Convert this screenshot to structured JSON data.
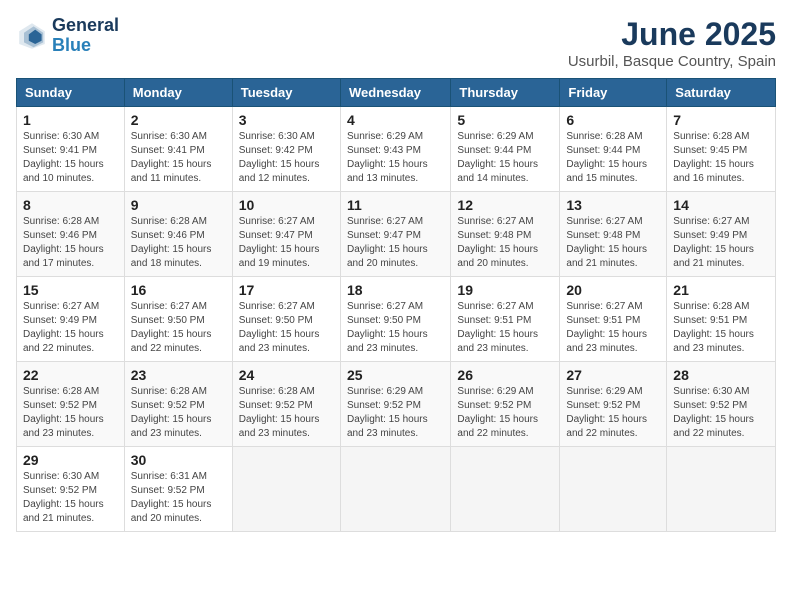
{
  "header": {
    "logo_line1": "General",
    "logo_line2": "Blue",
    "month_title": "June 2025",
    "location": "Usurbil, Basque Country, Spain"
  },
  "columns": [
    "Sunday",
    "Monday",
    "Tuesday",
    "Wednesday",
    "Thursday",
    "Friday",
    "Saturday"
  ],
  "weeks": [
    [
      {
        "day": "1",
        "sunrise": "6:30 AM",
        "sunset": "9:41 PM",
        "daylight": "15 hours and 10 minutes."
      },
      {
        "day": "2",
        "sunrise": "6:30 AM",
        "sunset": "9:41 PM",
        "daylight": "15 hours and 11 minutes."
      },
      {
        "day": "3",
        "sunrise": "6:30 AM",
        "sunset": "9:42 PM",
        "daylight": "15 hours and 12 minutes."
      },
      {
        "day": "4",
        "sunrise": "6:29 AM",
        "sunset": "9:43 PM",
        "daylight": "15 hours and 13 minutes."
      },
      {
        "day": "5",
        "sunrise": "6:29 AM",
        "sunset": "9:44 PM",
        "daylight": "15 hours and 14 minutes."
      },
      {
        "day": "6",
        "sunrise": "6:28 AM",
        "sunset": "9:44 PM",
        "daylight": "15 hours and 15 minutes."
      },
      {
        "day": "7",
        "sunrise": "6:28 AM",
        "sunset": "9:45 PM",
        "daylight": "15 hours and 16 minutes."
      }
    ],
    [
      {
        "day": "8",
        "sunrise": "6:28 AM",
        "sunset": "9:46 PM",
        "daylight": "15 hours and 17 minutes."
      },
      {
        "day": "9",
        "sunrise": "6:28 AM",
        "sunset": "9:46 PM",
        "daylight": "15 hours and 18 minutes."
      },
      {
        "day": "10",
        "sunrise": "6:27 AM",
        "sunset": "9:47 PM",
        "daylight": "15 hours and 19 minutes."
      },
      {
        "day": "11",
        "sunrise": "6:27 AM",
        "sunset": "9:47 PM",
        "daylight": "15 hours and 20 minutes."
      },
      {
        "day": "12",
        "sunrise": "6:27 AM",
        "sunset": "9:48 PM",
        "daylight": "15 hours and 20 minutes."
      },
      {
        "day": "13",
        "sunrise": "6:27 AM",
        "sunset": "9:48 PM",
        "daylight": "15 hours and 21 minutes."
      },
      {
        "day": "14",
        "sunrise": "6:27 AM",
        "sunset": "9:49 PM",
        "daylight": "15 hours and 21 minutes."
      }
    ],
    [
      {
        "day": "15",
        "sunrise": "6:27 AM",
        "sunset": "9:49 PM",
        "daylight": "15 hours and 22 minutes."
      },
      {
        "day": "16",
        "sunrise": "6:27 AM",
        "sunset": "9:50 PM",
        "daylight": "15 hours and 22 minutes."
      },
      {
        "day": "17",
        "sunrise": "6:27 AM",
        "sunset": "9:50 PM",
        "daylight": "15 hours and 23 minutes."
      },
      {
        "day": "18",
        "sunrise": "6:27 AM",
        "sunset": "9:50 PM",
        "daylight": "15 hours and 23 minutes."
      },
      {
        "day": "19",
        "sunrise": "6:27 AM",
        "sunset": "9:51 PM",
        "daylight": "15 hours and 23 minutes."
      },
      {
        "day": "20",
        "sunrise": "6:27 AM",
        "sunset": "9:51 PM",
        "daylight": "15 hours and 23 minutes."
      },
      {
        "day": "21",
        "sunrise": "6:28 AM",
        "sunset": "9:51 PM",
        "daylight": "15 hours and 23 minutes."
      }
    ],
    [
      {
        "day": "22",
        "sunrise": "6:28 AM",
        "sunset": "9:52 PM",
        "daylight": "15 hours and 23 minutes."
      },
      {
        "day": "23",
        "sunrise": "6:28 AM",
        "sunset": "9:52 PM",
        "daylight": "15 hours and 23 minutes."
      },
      {
        "day": "24",
        "sunrise": "6:28 AM",
        "sunset": "9:52 PM",
        "daylight": "15 hours and 23 minutes."
      },
      {
        "day": "25",
        "sunrise": "6:29 AM",
        "sunset": "9:52 PM",
        "daylight": "15 hours and 23 minutes."
      },
      {
        "day": "26",
        "sunrise": "6:29 AM",
        "sunset": "9:52 PM",
        "daylight": "15 hours and 22 minutes."
      },
      {
        "day": "27",
        "sunrise": "6:29 AM",
        "sunset": "9:52 PM",
        "daylight": "15 hours and 22 minutes."
      },
      {
        "day": "28",
        "sunrise": "6:30 AM",
        "sunset": "9:52 PM",
        "daylight": "15 hours and 22 minutes."
      }
    ],
    [
      {
        "day": "29",
        "sunrise": "6:30 AM",
        "sunset": "9:52 PM",
        "daylight": "15 hours and 21 minutes."
      },
      {
        "day": "30",
        "sunrise": "6:31 AM",
        "sunset": "9:52 PM",
        "daylight": "15 hours and 20 minutes."
      },
      null,
      null,
      null,
      null,
      null
    ]
  ],
  "labels": {
    "sunrise": "Sunrise:",
    "sunset": "Sunset:",
    "daylight": "Daylight:"
  }
}
